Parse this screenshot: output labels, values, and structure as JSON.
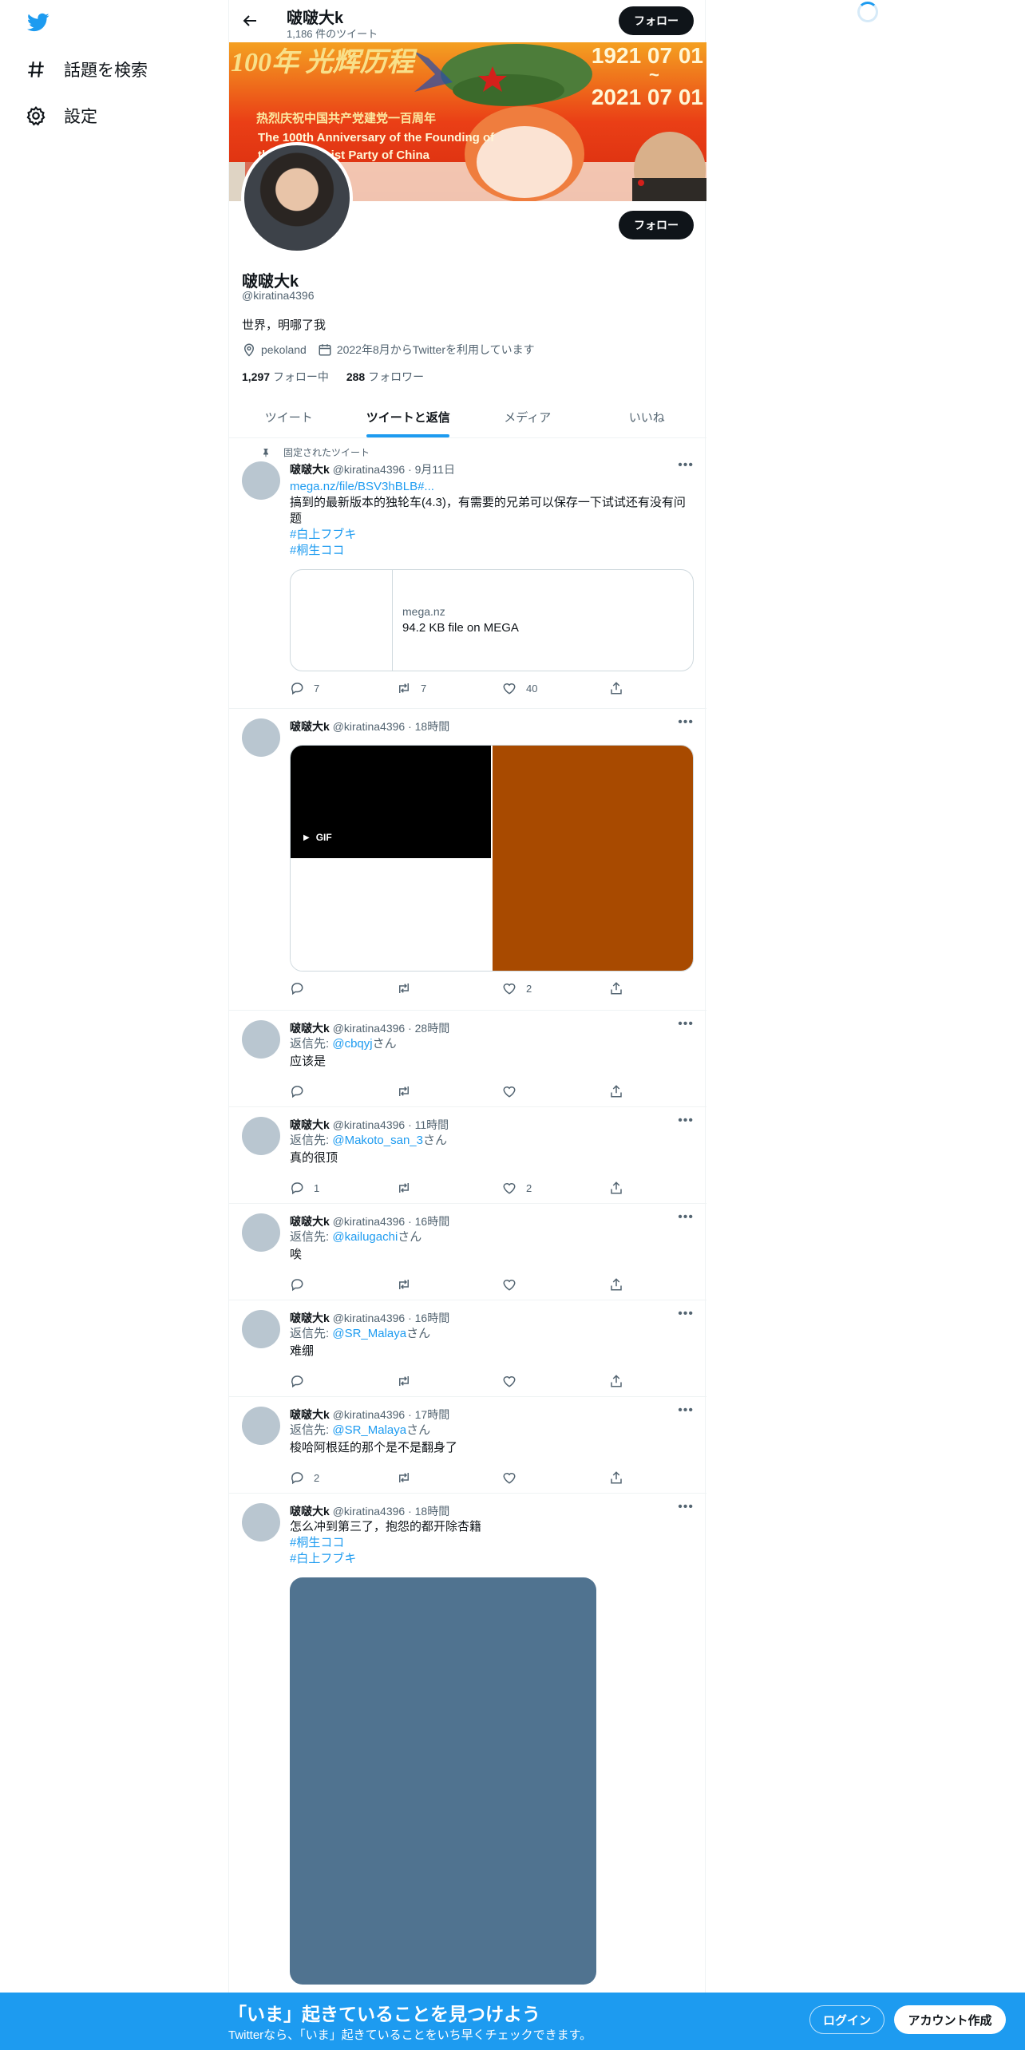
{
  "sidebar": {
    "logo": "twitter-bird-icon",
    "items": [
      {
        "label": "話題を検索",
        "icon": "hashtag-icon"
      },
      {
        "label": "設定",
        "icon": "gear-icon"
      }
    ]
  },
  "header": {
    "name": "啵啵大k",
    "tweet_count": "1,186 件のツイート",
    "follow_label": "フォロー"
  },
  "banner": {
    "date_top": "1921 07 01",
    "tilde": "~",
    "date_bottom": "2021 07 01",
    "line_cn": "热烈庆祝中国共产党建党一百周年",
    "line_en1": "The 100th Anniversary of the Founding of",
    "line_en2": "the Communist Party of China",
    "calligraphy": "100年 光辉历程"
  },
  "profile": {
    "name": "啵啵大k",
    "handle": "@kiratina4396",
    "bio": "世界，明哪了我",
    "location": "pekoland",
    "joined": "2022年8月からTwitterを利用しています",
    "following_count": "1,297",
    "following_label": "フォロー中",
    "followers_count": "288",
    "followers_label": "フォロワー",
    "follow_label": "フォロー"
  },
  "tabs": [
    {
      "label": "ツイート",
      "active": false
    },
    {
      "label": "ツイートと返信",
      "active": true
    },
    {
      "label": "メディア",
      "active": false
    },
    {
      "label": "いいね",
      "active": false
    }
  ],
  "tweets": [
    {
      "pinned_label": "固定されたツイート",
      "name": "啵啵大k",
      "handle": "@kiratina4396",
      "time": "9月11日",
      "link": "mega.nz/file/BSV3hBLB#...",
      "text": "搞到的最新版本的独轮车(4.3)，有需要的兄弟可以保存一下试试还有没有问题",
      "hashtags": [
        "#白上フブキ",
        "#桐生ココ"
      ],
      "card": {
        "domain": "mega.nz",
        "title": "94.2 KB file on MEGA"
      },
      "replies": "7",
      "retweets": "7",
      "likes": "40"
    },
    {
      "name": "啵啵大k",
      "handle": "@kiratina4396",
      "time": "18時間",
      "gif_label": "GIF",
      "replies": "",
      "retweets": "",
      "likes": "2"
    },
    {
      "name": "啵啵大k",
      "handle": "@kiratina4396",
      "time": "28時間",
      "reply_prefix": "返信先: ",
      "reply_to": "@cbqyj",
      "reply_suffix": "さん",
      "text": "应该是",
      "replies": "",
      "retweets": "",
      "likes": ""
    },
    {
      "name": "啵啵大k",
      "handle": "@kiratina4396",
      "time": "11時間",
      "reply_prefix": "返信先: ",
      "reply_to": "@Makoto_san_3",
      "reply_suffix": "さん",
      "text": "真的很顶",
      "replies": "1",
      "retweets": "",
      "likes": "2"
    },
    {
      "name": "啵啵大k",
      "handle": "@kiratina4396",
      "time": "16時間",
      "reply_prefix": "返信先: ",
      "reply_to": "@kailugachi",
      "reply_suffix": "さん",
      "text": "唉",
      "replies": "",
      "retweets": "",
      "likes": ""
    },
    {
      "name": "啵啵大k",
      "handle": "@kiratina4396",
      "time": "16時間",
      "reply_prefix": "返信先: ",
      "reply_to": "@SR_Malaya",
      "reply_suffix": "さん",
      "text": "难绷",
      "replies": "",
      "retweets": "",
      "likes": ""
    },
    {
      "name": "啵啵大k",
      "handle": "@kiratina4396",
      "time": "17時間",
      "reply_prefix": "返信先: ",
      "reply_to": "@SR_Malaya",
      "reply_suffix": "さん",
      "text": "梭哈阿根廷的那个是不是翻身了",
      "replies": "2",
      "retweets": "",
      "likes": ""
    },
    {
      "name": "啵啵大k",
      "handle": "@kiratina4396",
      "time": "18時間",
      "text": "怎么冲到第三了，抱怨的都开除杏籍",
      "hashtags": [
        "#桐生ココ",
        "#白上フブキ"
      ]
    }
  ],
  "footer": {
    "title": "「いま」起きていることを見つけよう",
    "subtitle": "Twitterなら、「いま」起きていることをいち早くチェックできます。",
    "login_label": "ログイン",
    "signup_label": "アカウント作成"
  },
  "colors": {
    "accent": "#1d9bf0",
    "banner_red": "#e84c1e",
    "media_orange": "#a84a00",
    "media_slate": "#507390",
    "placeholder_avatar": "#b9c6d0"
  }
}
